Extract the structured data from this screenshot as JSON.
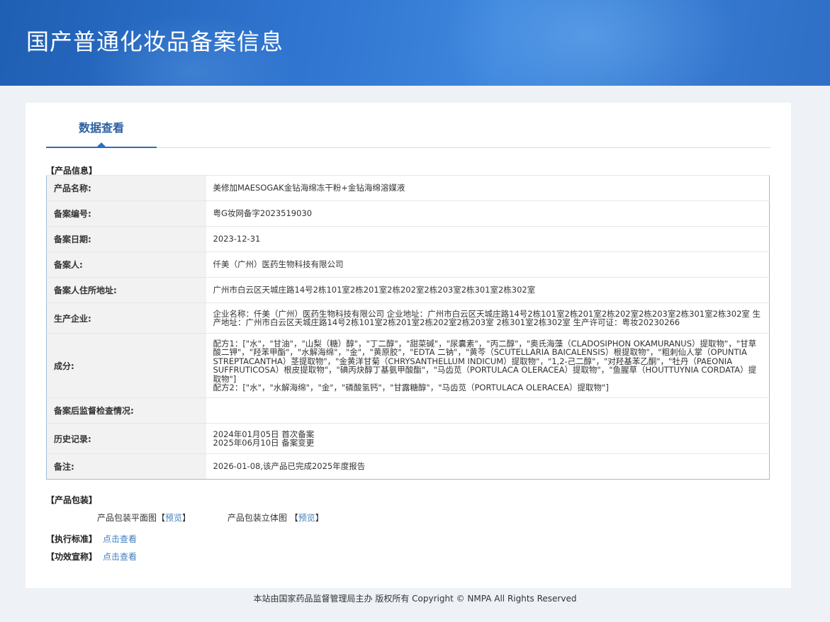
{
  "header": {
    "title": "国产普通化妆品备案信息"
  },
  "tabs": [
    {
      "label": "数据查看"
    }
  ],
  "product_info": {
    "section_label": "【产品信息】",
    "rows": [
      {
        "label": "产品名称:",
        "value": "美修加MAESOGAK金钻海绵冻干粉+金钻海绵溶媒液"
      },
      {
        "label": "备案编号:",
        "value": "粤G妆网备字2023519030"
      },
      {
        "label": "备案日期:",
        "value": "2023-12-31"
      },
      {
        "label": "备案人:",
        "value": "仟美（广州）医药生物科技有限公司"
      },
      {
        "label": "备案人住所地址:",
        "value": "广州市白云区天城庄路14号2栋101室2栋201室2栋202室2栋203室2栋301室2栋302室"
      },
      {
        "label": "生产企业:",
        "value": "企业名称：仟美（广州）医药生物科技有限公司 企业地址：广州市白云区天城庄路14号2栋101室2栋201室2栋202室2栋203室2栋301室2栋302室 生产地址：广州市白云区天城庄路14号2栋101室2栋201室2栋202室2栋203室 2栋301室2栋302室 生产许可证：粤妆20230266"
      },
      {
        "label": "成分:",
        "value": "配方1：[\"水\"，\"甘油\"，\"山梨（糖）醇\"，\"丁二醇\"，\"甜菜碱\"，\"尿囊素\"，\"丙二醇\"，\"奥氏海藻（CLADOSIPHON OKAMURANUS）提取物\"，\"甘草酸二钾\"，\"羟苯甲酯\"，\"水解海绵\"，\"金\"，\"黄原胶\"，\"EDTA 二钠\"，\"黄芩（SCUTELLARIA BAICALENSIS）根提取物\"，\"粗刺仙人掌（OPUNTIA STREPTACANTHA）茎提取物\"，\"金黄洋甘菊（CHRYSANTHELLUM INDICUM）提取物\"，\"1,2-己二醇\"，\"对羟基苯乙酮\"，\"牡丹（PAEONIA SUFFRUTICOSA）根皮提取物\"，\"碘丙炔醇丁基氨甲酸酯\"，\"马齿苋（PORTULACA OLERACEA）提取物\"，\"鱼腥草（HOUTTUYNIA CORDATA）提取物\"]\n配方2：[\"水\"，\"水解海绵\"，\"金\"，\"磷酸氢钙\"，\"甘露糖醇\"，\"马齿苋（PORTULACA OLERACEA）提取物\"]"
      },
      {
        "label": "备案后监督检查情况:",
        "value": ""
      },
      {
        "label": "历史记录:",
        "value": "2024年01月05日 首次备案\n2025年06月10日 备案变更"
      },
      {
        "label": "备注:",
        "value": "2026-01-08,该产品已完成2025年度报告"
      }
    ]
  },
  "packaging": {
    "section_label": "【产品包装】",
    "items": [
      {
        "label": "产品包装平面图",
        "link": "预览"
      },
      {
        "label": "产品包装立体图 ",
        "link": "预览"
      }
    ]
  },
  "standard": {
    "section_label": "【执行标准】",
    "link": "点击查看"
  },
  "efficacy": {
    "section_label": "【功效宣称】",
    "link": "点击查看"
  },
  "footer": {
    "text": "本站由国家药品监督管理局主办 版权所有 Copyright © NMPA All Rights Reserved"
  },
  "colors": {
    "banner": "#2f74cf",
    "accent": "#2c6fbf",
    "link": "#3f7fbf"
  }
}
